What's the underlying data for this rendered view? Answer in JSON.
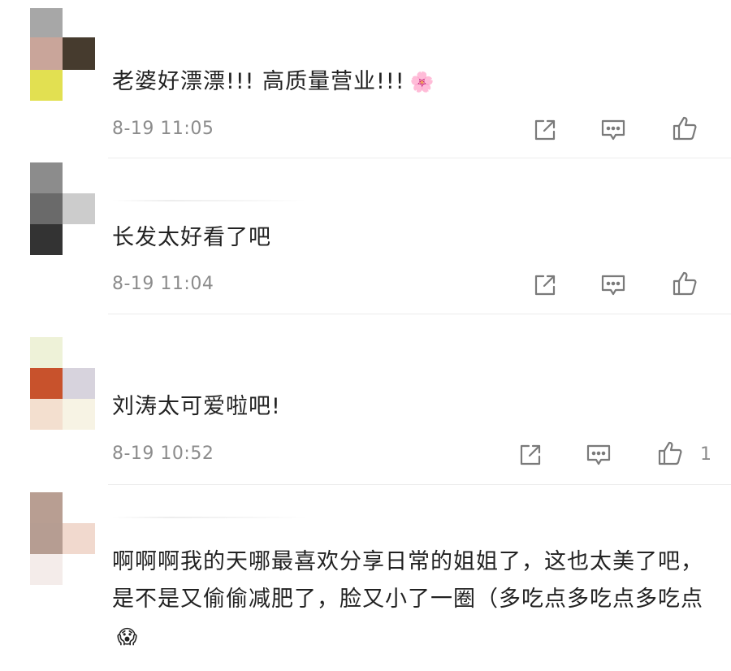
{
  "comments": [
    {
      "text": "老婆好漂漂!!! 高质量营业!!!",
      "emoji": "🌸",
      "time": "8-19 11:05",
      "likes": "",
      "avatar_colors": [
        "#a0a0a0",
        "#c9a59a",
        "#463b2e",
        "#e2e051"
      ]
    },
    {
      "text": "长发太好看了吧",
      "emoji": "",
      "time": "8-19 11:04",
      "likes": "",
      "avatar_colors": [
        "#8a8a8a",
        "#666666",
        "#c8c8c8",
        "#333333"
      ]
    },
    {
      "text": "刘涛太可爱啦吧!",
      "emoji": "",
      "time": "8-19 10:52",
      "likes": "1",
      "avatar_colors": [
        "#eef2d8",
        "#c8522c",
        "#d7d3dd",
        "#f3dfcf"
      ]
    },
    {
      "text": "啊啊啊我的天哪最喜欢分享日常的姐姐了，这也太美了吧，是不是又偷偷减肥了，脸又小了一圈（多吃点多吃点多吃点",
      "emoji": "😱",
      "time": "",
      "likes": "",
      "avatar_colors": [
        "#b89e92",
        "#b69d92",
        "#f1d9ce",
        "#f4ecea"
      ]
    }
  ],
  "icons": {
    "share": "share-icon",
    "comment": "comment-bubble-icon",
    "like": "thumbs-up-icon"
  }
}
